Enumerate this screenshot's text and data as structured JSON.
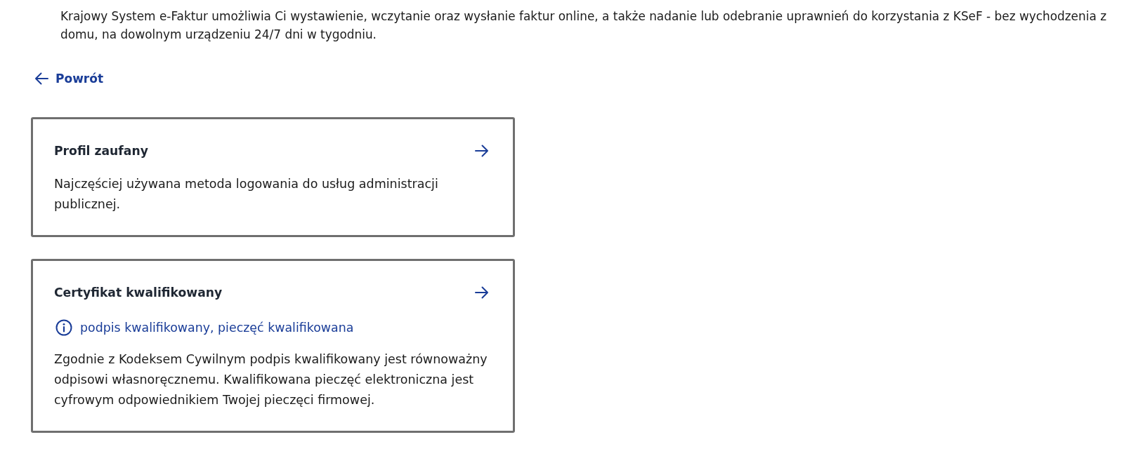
{
  "intro": "Krajowy System e-Faktur umożliwia Ci wystawienie, wczytanie oraz wysłanie faktur online, a także nadanie lub odebranie uprawnień do korzystania z KSeF - bez wychodzenia z domu, na dowolnym urządzeniu 24/7 dni w tygodniu.",
  "back_link": {
    "label": "Powrót"
  },
  "options": [
    {
      "title": "Profil zaufany",
      "description": "Najczęściej używana metoda logowania do usług administracji publicznej."
    },
    {
      "title": "Certyfikat kwalifikowany",
      "info": "podpis kwalifikowany, pieczęć kwalifikowana",
      "description": "Zgodnie z Kodeksem Cywilnym podpis kwalifikowany jest równoważny odpisowi własnoręcznemu. Kwalifikowana pieczęć elektroniczna jest cyfrowym odpowiednikiem Twojej pieczęci firmowej."
    }
  ]
}
